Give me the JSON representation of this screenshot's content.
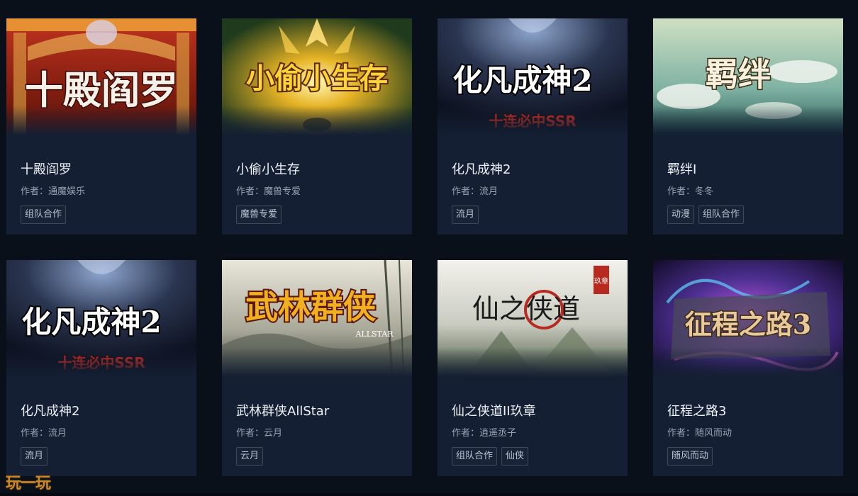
{
  "author_prefix": "作者：",
  "games": [
    {
      "title": "十殿阎罗",
      "author": "通魔娱乐",
      "tags": [
        "组队合作"
      ],
      "banner_text": "十殿阎罗",
      "banner_theme": "red-stage"
    },
    {
      "title": "小偷小生存",
      "author": "魔兽专爱",
      "tags": [
        "魔兽专爱"
      ],
      "banner_text": "小偷小生存",
      "banner_theme": "gold-burst"
    },
    {
      "title": "化凡成神2",
      "author": "流月",
      "tags": [
        "流月"
      ],
      "banner_text": "化凡成神2",
      "banner_subtext": "十连必中SSR",
      "banner_theme": "dark-ink"
    },
    {
      "title": "羁绊I",
      "author": "冬冬",
      "tags": [
        "动漫",
        "组队合作"
      ],
      "banner_text": "羁绊",
      "banner_theme": "teal-clouds"
    },
    {
      "title": "化凡成神2",
      "author": "流月",
      "tags": [
        "流月"
      ],
      "banner_text": "化凡成神2",
      "banner_subtext": "十连必中SSR",
      "banner_theme": "dark-ink"
    },
    {
      "title": "武林群侠AllStar",
      "author": "云月",
      "tags": [
        "云月"
      ],
      "banner_text": "武林群侠",
      "banner_subtext": "ALLSTAR",
      "banner_theme": "ink-landscape"
    },
    {
      "title": "仙之侠道II玖章",
      "author": "逍遥丞子",
      "tags": [
        "组队合作",
        "仙侠"
      ],
      "banner_text": "仙之侠道",
      "banner_subtext": "玖章",
      "banner_theme": "pale-mountain"
    },
    {
      "title": "征程之路3",
      "author": "随风而动",
      "tags": [
        "随风而动"
      ],
      "banner_text": "征程之路3",
      "banner_theme": "purple-nebula"
    }
  ],
  "logo_text": "玩一玩",
  "colors": {
    "page_bg": "#0a1019",
    "card_bg": "#141f33",
    "tag_border": "#3d4a5e"
  }
}
